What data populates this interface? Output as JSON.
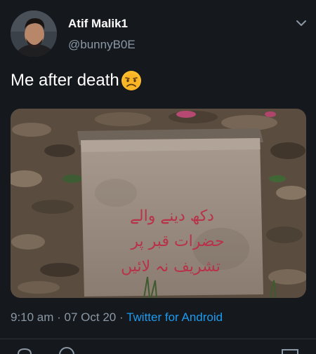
{
  "author": {
    "name": "Atif Malik1",
    "handle": "@bunnyB0E"
  },
  "tweet": {
    "text": "Me after death",
    "emoji": "worried-face-emoji"
  },
  "media": {
    "tombstone_inscription": [
      "دکھ دینے والے",
      "حضرات قبر پر",
      "تشریف نہ لائیں"
    ]
  },
  "meta": {
    "time": "9:10 am",
    "separator": " · ",
    "date": "07 Oct 20",
    "source": "Twitter for Android"
  },
  "icons": {
    "menu": "chevron-down-icon",
    "reply": "reply-icon",
    "retweet": "retweet-icon",
    "share": "share-icon"
  },
  "colors": {
    "background": "#15181c",
    "secondary_text": "#8b98a5",
    "link": "#1d9bf0"
  }
}
